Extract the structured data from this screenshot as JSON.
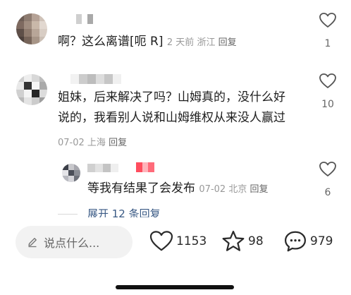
{
  "comments": [
    {
      "text": "啊？这么离谱[呃 R]",
      "time": "2 天前",
      "location": "浙江",
      "reply_label": "回复",
      "likes": "1"
    },
    {
      "text_line1": "姐妹，后来解决了吗？山姆真的，没什么好",
      "text_line2": "说的，我看别人说和山姆维权从来没人赢过",
      "time": "07-02",
      "location": "上海",
      "reply_label": "回复",
      "likes": "10"
    },
    {
      "text": "等我有结果了会发布",
      "time": "07-02",
      "location": "北京",
      "reply_label": "回复",
      "likes": "6"
    }
  ],
  "expand_replies": "展开 12 条回复",
  "bottom_bar": {
    "input_placeholder": "说点什么...",
    "likes": "1153",
    "favorites": "98",
    "comments": "979"
  },
  "icons": {
    "like": "heart-outline-icon",
    "favorite": "star-outline-icon",
    "comment": "chat-bubble-icon",
    "edit": "pencil-icon"
  }
}
